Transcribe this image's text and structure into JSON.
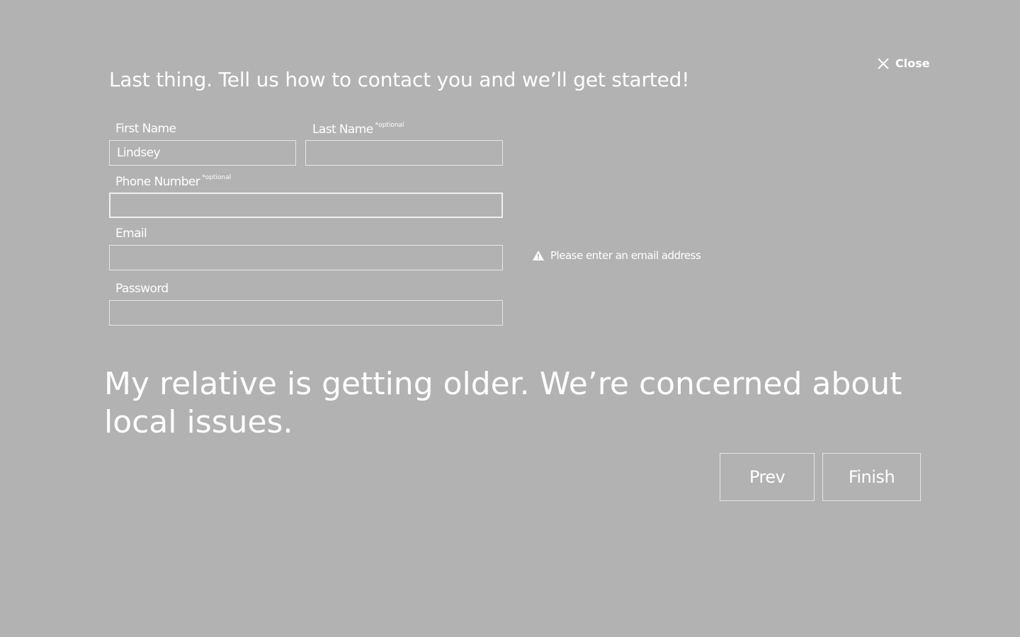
{
  "close": {
    "label": "Close",
    "icon": "close-icon"
  },
  "headline": "Last thing. Tell us how to contact you and we’ll get started!",
  "form": {
    "first_name": {
      "label": "First Name",
      "value": "Lindsey"
    },
    "last_name": {
      "label": "Last Name",
      "optional_tag": "*optional",
      "value": ""
    },
    "phone": {
      "label": "Phone Number",
      "optional_tag": "*optional",
      "value": ""
    },
    "email": {
      "label": "Email",
      "value": "",
      "error": "Please enter an email address",
      "error_icon": "warning-icon"
    },
    "password": {
      "label": "Password",
      "value": ""
    }
  },
  "question": "My relative is getting older. We’re concerned about local issues.",
  "buttons": {
    "prev": "Prev",
    "finish": "Finish"
  },
  "colors": {
    "background": "#b2b2b2",
    "text": "#ffffff",
    "border": "#e6e6e6"
  }
}
